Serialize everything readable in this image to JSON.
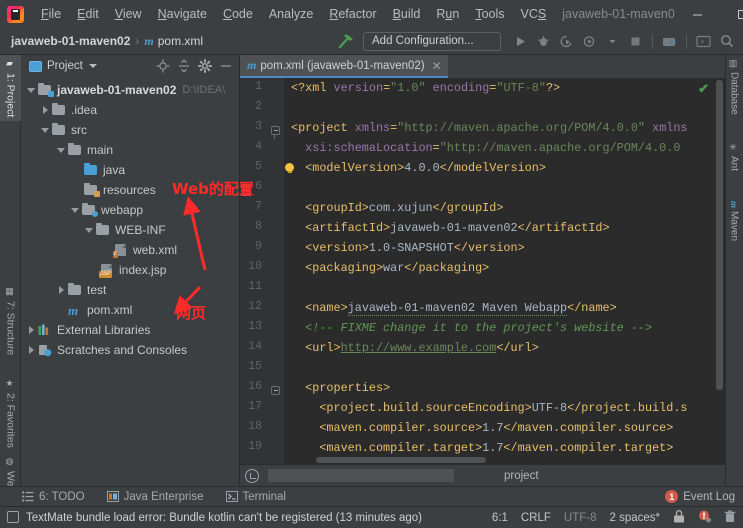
{
  "window": {
    "title": "javaweb-01-maven0",
    "minimize": "—",
    "maximize": "▢",
    "close": "✕"
  },
  "menubar": {
    "logo": "intellij-idea-logo",
    "items": [
      {
        "label": "File",
        "mnemonic": "F"
      },
      {
        "label": "Edit",
        "mnemonic": "E"
      },
      {
        "label": "View",
        "mnemonic": "V"
      },
      {
        "label": "Navigate",
        "mnemonic": "N"
      },
      {
        "label": "Code",
        "mnemonic": "C"
      },
      {
        "label": "Analyze",
        "mnemonic": "A"
      },
      {
        "label": "Refactor",
        "mnemonic": "R"
      },
      {
        "label": "Build",
        "mnemonic": "B"
      },
      {
        "label": "Run",
        "mnemonic": "u"
      },
      {
        "label": "Tools",
        "mnemonic": "T"
      },
      {
        "label": "VCS",
        "mnemonic": "S"
      }
    ]
  },
  "navbar": {
    "crumb_project": "javaweb-01-maven02",
    "separator": "›",
    "crumb_file": "pom.xml",
    "file_icon": "m",
    "run_config_placeholder": "Add Configuration...",
    "buttons": [
      {
        "name": "build-hammer-icon"
      },
      {
        "name": "run-button"
      },
      {
        "name": "debug-button"
      },
      {
        "name": "run-with-coverage-button"
      },
      {
        "name": "profile-button"
      },
      {
        "name": "stop-button"
      },
      {
        "name": "project-structure-button"
      },
      {
        "name": "terminal-button"
      },
      {
        "name": "search-everywhere-button"
      }
    ]
  },
  "left_stripe": {
    "tabs": [
      {
        "label": "1: Project",
        "mnemonic": "1",
        "active": true
      },
      {
        "label": "7: Structure",
        "mnemonic": "7",
        "active": false
      },
      {
        "label": "2: Favorites",
        "mnemonic": "2",
        "active": false
      },
      {
        "label": "Web",
        "mnemonic": "",
        "active": false
      }
    ]
  },
  "right_stripe": {
    "tabs": [
      {
        "label": "Database"
      },
      {
        "label": "Ant"
      },
      {
        "label": "Maven"
      }
    ]
  },
  "project_panel": {
    "title": "Project",
    "toolbar": [
      {
        "name": "locate-icon"
      },
      {
        "name": "collapse-all-icon"
      },
      {
        "name": "settings-gear-icon"
      },
      {
        "name": "hide-icon"
      }
    ],
    "tree": [
      {
        "label": "javaweb-01-maven02",
        "path": "D:\\IDEA\\",
        "depth": 0,
        "arrow": "down",
        "icon": "module-folder",
        "bold": true
      },
      {
        "label": ".idea",
        "path": "",
        "depth": 1,
        "arrow": "right",
        "icon": "folder",
        "bold": false
      },
      {
        "label": "src",
        "path": "",
        "depth": 1,
        "arrow": "down",
        "icon": "folder",
        "bold": false
      },
      {
        "label": "main",
        "path": "",
        "depth": 2,
        "arrow": "down",
        "icon": "folder",
        "bold": false
      },
      {
        "label": "java",
        "path": "",
        "depth": 3,
        "arrow": "none",
        "icon": "source-folder",
        "bold": false
      },
      {
        "label": "resources",
        "path": "",
        "depth": 3,
        "arrow": "none",
        "icon": "resource-folder",
        "bold": false
      },
      {
        "label": "webapp",
        "path": "",
        "depth": 3,
        "arrow": "down",
        "icon": "web-folder",
        "bold": false
      },
      {
        "label": "WEB-INF",
        "path": "",
        "depth": 4,
        "arrow": "down",
        "icon": "folder",
        "bold": false
      },
      {
        "label": "web.xml",
        "path": "",
        "depth": 5,
        "arrow": "none",
        "icon": "xml-file",
        "bold": false
      },
      {
        "label": "index.jsp",
        "path": "",
        "depth": 4,
        "arrow": "none",
        "icon": "jsp-file",
        "bold": false
      },
      {
        "label": "test",
        "path": "",
        "depth": 2,
        "arrow": "right",
        "icon": "folder",
        "bold": false
      },
      {
        "label": "pom.xml",
        "path": "",
        "depth": 2,
        "arrow": "none",
        "icon": "maven-file",
        "bold": false
      },
      {
        "label": "External Libraries",
        "path": "",
        "depth": 0,
        "arrow": "right",
        "icon": "libraries",
        "bold": false
      },
      {
        "label": "Scratches and Consoles",
        "path": "",
        "depth": 0,
        "arrow": "right",
        "icon": "scratches",
        "bold": false
      }
    ]
  },
  "editor": {
    "tab_label": "pom.xml (javaweb-01-maven02)",
    "tab_icon": "m",
    "tab_close": "✕",
    "inspection_status": "✔",
    "breadcrumb": "project",
    "lines": [
      {
        "n": 1,
        "text": "<?xml version=\"1.0\" encoding=\"UTF-8\"?>"
      },
      {
        "n": 2,
        "text": ""
      },
      {
        "n": 3,
        "text": "<project xmlns=\"http://maven.apache.org/POM/4.0.0\" xmlns"
      },
      {
        "n": 4,
        "text": "  xsi:schemaLocation=\"http://maven.apache.org/POM/4.0.0"
      },
      {
        "n": 5,
        "text": "  <modelVersion>4.0.0</modelVersion>"
      },
      {
        "n": 6,
        "text": ""
      },
      {
        "n": 7,
        "text": "  <groupId>com.xujun</groupId>"
      },
      {
        "n": 8,
        "text": "  <artifactId>javaweb-01-maven02</artifactId>"
      },
      {
        "n": 9,
        "text": "  <version>1.0-SNAPSHOT</version>"
      },
      {
        "n": 10,
        "text": "  <packaging>war</packaging>"
      },
      {
        "n": 11,
        "text": ""
      },
      {
        "n": 12,
        "text": "  <name>javaweb-01-maven02 Maven Webapp</name>"
      },
      {
        "n": 13,
        "text": "  <!-- FIXME change it to the project's website -->"
      },
      {
        "n": 14,
        "text": "  <url>http://www.example.com</url>"
      },
      {
        "n": 15,
        "text": ""
      },
      {
        "n": 16,
        "text": "  <properties>"
      },
      {
        "n": 17,
        "text": "    <project.build.sourceEncoding>UTF-8</project.build.s"
      },
      {
        "n": 18,
        "text": "    <maven.compiler.source>1.7</maven.compiler.source>"
      },
      {
        "n": 19,
        "text": "    <maven.compiler.target>1.7</maven.compiler.target>"
      }
    ]
  },
  "annotations": [
    {
      "text": "Web的配置",
      "target": "web.xml",
      "color": "#ff2a2a"
    },
    {
      "text": "网页",
      "target": "index.jsp",
      "color": "#ff2a2a"
    }
  ],
  "bottom_stripe": {
    "tabs": [
      {
        "label": "6: TODO",
        "mnemonic": "6",
        "icon": "todo-icon"
      },
      {
        "label": "Java Enterprise",
        "mnemonic": "",
        "icon": "java-enterprise-icon"
      },
      {
        "label": "Terminal",
        "mnemonic": "",
        "icon": "terminal-icon"
      }
    ],
    "event_log": {
      "label": "Event Log",
      "count": "1"
    }
  },
  "statusbar": {
    "message": "TextMate bundle load error: Bundle kotlin can't be registered (13 minutes ago)",
    "caret_position": "6:1",
    "line_separator": "CRLF",
    "encoding": "UTF-8",
    "indent": "2 spaces*",
    "icons": [
      {
        "name": "lock-icon"
      },
      {
        "name": "error-notification-icon"
      },
      {
        "name": "trash-icon"
      }
    ]
  }
}
